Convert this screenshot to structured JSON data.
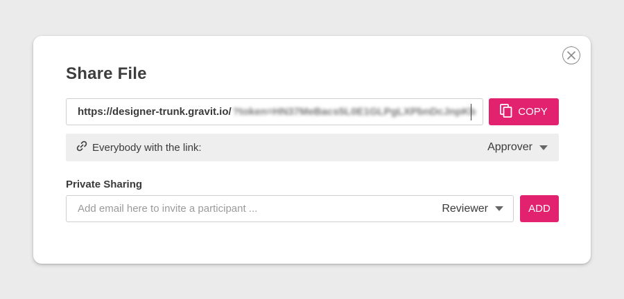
{
  "dialog": {
    "title": "Share File",
    "close_icon": "close-circle-icon"
  },
  "share_link": {
    "url_visible": "https://designer-trunk.gravit.io/",
    "url_obscured": "?token=HN37MeBacs5L0E1GLPgLXPbnDcJnpKb",
    "copy_label": "COPY",
    "copy_icon": "copy-icon"
  },
  "link_access": {
    "icon": "link-icon",
    "label": "Everybody with the link:",
    "role": "Approver"
  },
  "private_sharing": {
    "label": "Private Sharing",
    "email_placeholder": "Add email here to invite a participant ...",
    "email_value": "",
    "role": "Reviewer",
    "add_label": "ADD"
  },
  "colors": {
    "accent": "#e2216f",
    "background": "#ebebeb",
    "dialog": "#ffffff",
    "row_bg": "#eeeeee"
  }
}
